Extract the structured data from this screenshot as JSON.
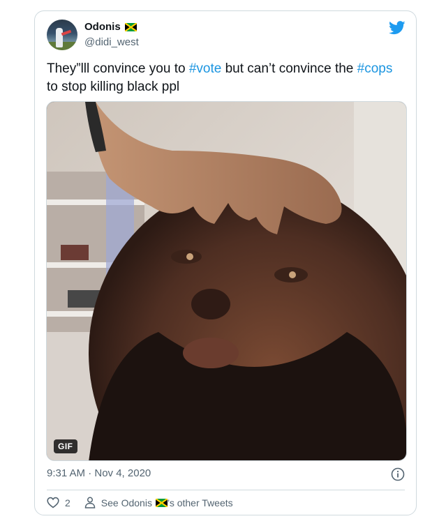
{
  "tweet": {
    "display_name": "Odonis",
    "handle": "@didi_west",
    "text_parts": [
      {
        "text": "They”lll convince you to ",
        "type": "text"
      },
      {
        "text": "#vote",
        "type": "hashtag"
      },
      {
        "text": " but can’t convince the ",
        "type": "text"
      },
      {
        "text": "#cops",
        "type": "hashtag"
      },
      {
        "text": " to stop killing black ppl",
        "type": "text"
      }
    ],
    "media": {
      "badge": "GIF"
    },
    "timestamp": "9:31 AM · Nov 4, 2020",
    "like_count": "2",
    "other_tweets_prefix": "See Odonis",
    "other_tweets_suffix": "’s other Tweets"
  },
  "icons": {
    "brand": "twitter-bird-icon",
    "info": "info-icon",
    "like": "heart-icon",
    "profile": "person-icon",
    "flag": "jamaica-flag-icon"
  },
  "colors": {
    "hashtag": "#1b95e0",
    "twitter_blue": "#1d9bf0",
    "secondary_text": "#536471",
    "border": "#cfd9de"
  }
}
